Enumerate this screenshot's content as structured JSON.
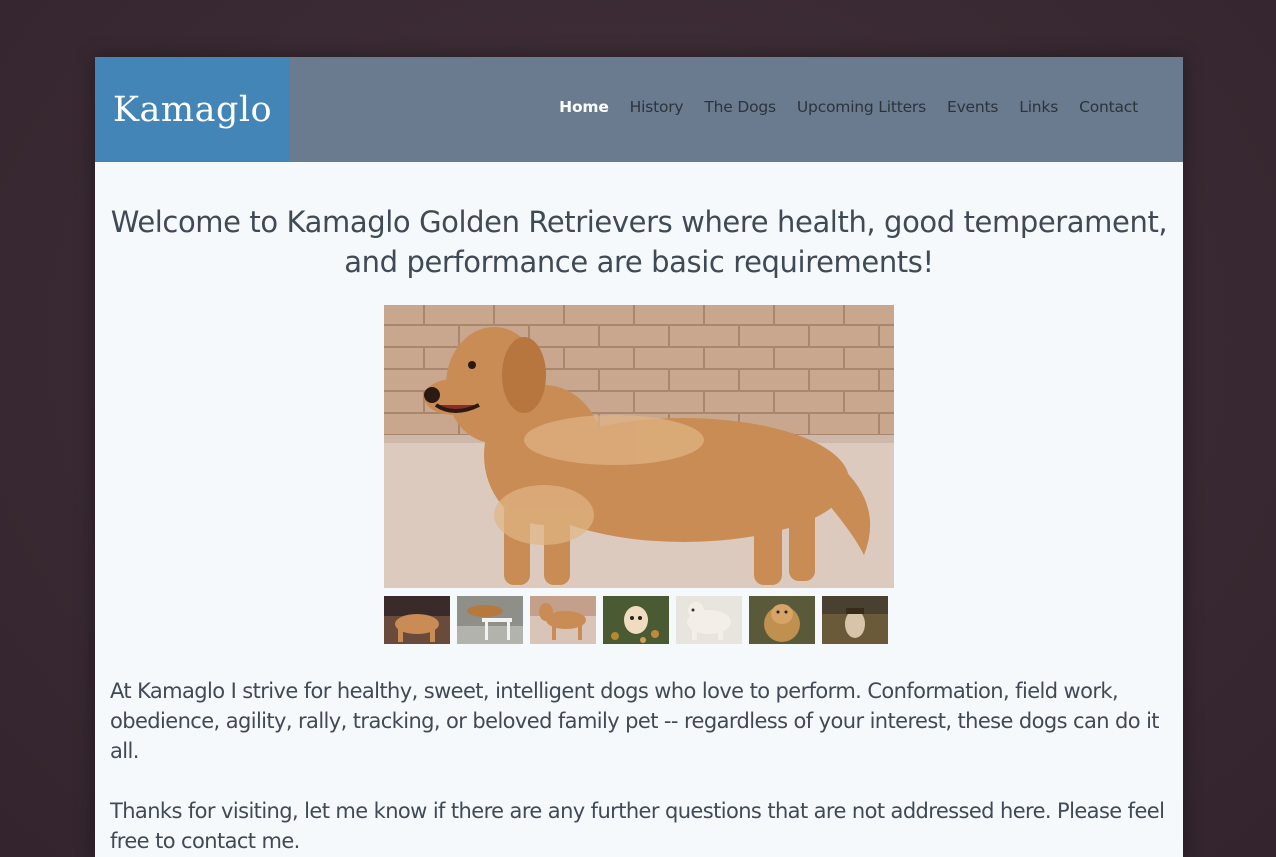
{
  "header": {
    "logo": "Kamaglo",
    "nav": [
      {
        "label": "Home",
        "active": true
      },
      {
        "label": "History",
        "active": false
      },
      {
        "label": "The Dogs",
        "active": false
      },
      {
        "label": "Upcoming Litters",
        "active": false
      },
      {
        "label": "Events",
        "active": false
      },
      {
        "label": "Links",
        "active": false
      },
      {
        "label": "Contact",
        "active": false
      }
    ]
  },
  "main": {
    "headline": "Welcome to Kamaglo Golden Retrievers where health, good temperament, and performance are basic requirements!",
    "paragraph1": "At Kamaglo I strive for healthy, sweet, intelligent dogs who love to perform. Conformation, field work, obedience, agility, rally, tracking, or beloved family pet -- regardless of your interest, these dogs can do it all.",
    "paragraph2": "Thanks for visiting, let me know if there are any further questions that are not addressed here. Please feel free to contact me."
  },
  "slider": {
    "thumbnail_count": 7
  },
  "colors": {
    "background": "#3a2a33",
    "header": "#6a7b90",
    "logo_bg": "#4385b6",
    "page_bg": "#f6f9fb",
    "text": "#404a55"
  }
}
